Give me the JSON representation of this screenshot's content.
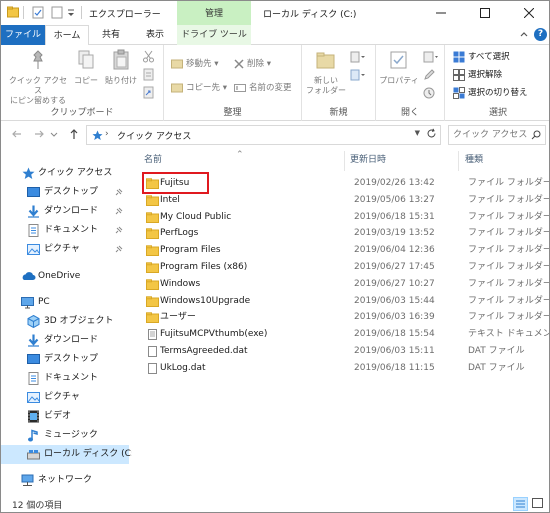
{
  "window": {
    "quick_access_title": "エクスプローラー",
    "context_tab_title": "管理",
    "drive_title": "ローカル ディスク (C:)"
  },
  "tabs": {
    "file": "ファイル",
    "home": "ホーム",
    "share": "共有",
    "view": "表示",
    "drive_tools": "ドライブ ツール"
  },
  "ribbon": {
    "clipboard": {
      "label": "クリップボード",
      "pin_quick_access_line1": "クイック アクセス",
      "pin_quick_access_line2": "にピン留めする",
      "copy": "コピー",
      "paste": "貼り付け"
    },
    "organize": {
      "label": "整理",
      "move_to": "移動先",
      "copy_to": "コピー先",
      "delete": "削除",
      "rename": "名前の変更"
    },
    "new": {
      "label": "新規",
      "new_folder_line1": "新しい",
      "new_folder_line2": "フォルダー"
    },
    "open": {
      "label": "開く",
      "properties": "プロパティ"
    },
    "select": {
      "label": "選択",
      "select_all": "すべて選択",
      "select_none": "選択解除",
      "invert_selection": "選択の切り替え"
    }
  },
  "address": {
    "path": "クイック アクセス",
    "search_placeholder": "クイック アクセス..."
  },
  "nav": {
    "quick_access": "クイック アクセス",
    "desktop": "デスクトップ",
    "downloads": "ダウンロード",
    "documents": "ドキュメント",
    "pictures": "ピクチャ",
    "onedrive": "OneDrive",
    "pc": "PC",
    "objects3d": "3D オブジェクト",
    "pc_downloads": "ダウンロード",
    "pc_desktop": "デスクトップ",
    "pc_documents": "ドキュメント",
    "pc_pictures": "ピクチャ",
    "videos": "ビデオ",
    "music": "ミュージック",
    "local_disk": "ローカル ディスク (C:)",
    "network": "ネットワーク"
  },
  "columns": {
    "name": "名前",
    "modified": "更新日時",
    "type": "種類"
  },
  "files": [
    {
      "name": "Fujitsu",
      "date": "2019/02/26 13:42",
      "type": "ファイル フォルダー",
      "kind": "folder"
    },
    {
      "name": "Intel",
      "date": "2019/05/06 13:27",
      "type": "ファイル フォルダー",
      "kind": "folder"
    },
    {
      "name": "My Cloud Public",
      "date": "2019/06/18 15:31",
      "type": "ファイル フォルダー",
      "kind": "folder"
    },
    {
      "name": "PerfLogs",
      "date": "2019/03/19 13:52",
      "type": "ファイル フォルダー",
      "kind": "folder"
    },
    {
      "name": "Program Files",
      "date": "2019/06/04 12:36",
      "type": "ファイル フォルダー",
      "kind": "folder"
    },
    {
      "name": "Program Files (x86)",
      "date": "2019/06/27 17:45",
      "type": "ファイル フォルダー",
      "kind": "folder"
    },
    {
      "name": "Windows",
      "date": "2019/06/27 10:27",
      "type": "ファイル フォルダー",
      "kind": "folder"
    },
    {
      "name": "Windows10Upgrade",
      "date": "2019/06/03 15:44",
      "type": "ファイル フォルダー",
      "kind": "folder"
    },
    {
      "name": "ユーザー",
      "date": "2019/06/03 16:39",
      "type": "ファイル フォルダー",
      "kind": "folder"
    },
    {
      "name": "FujitsuMCPVthumb(exe)",
      "date": "2019/06/18 15:54",
      "type": "テキスト ドキュメント",
      "kind": "text"
    },
    {
      "name": "TermsAgreeded.dat",
      "date": "2019/06/03 15:11",
      "type": "DAT ファイル",
      "kind": "file"
    },
    {
      "name": "UkLog.dat",
      "date": "2019/06/18 11:15",
      "type": "DAT ファイル",
      "kind": "file"
    }
  ],
  "status": {
    "item_count": "12 個の項目"
  },
  "colors": {
    "accent": "#1e6fc1",
    "folder": "#f3c645",
    "context_tab": "#c9f0c2",
    "selected": "#cce8ff",
    "highlight": "#e0191f"
  }
}
